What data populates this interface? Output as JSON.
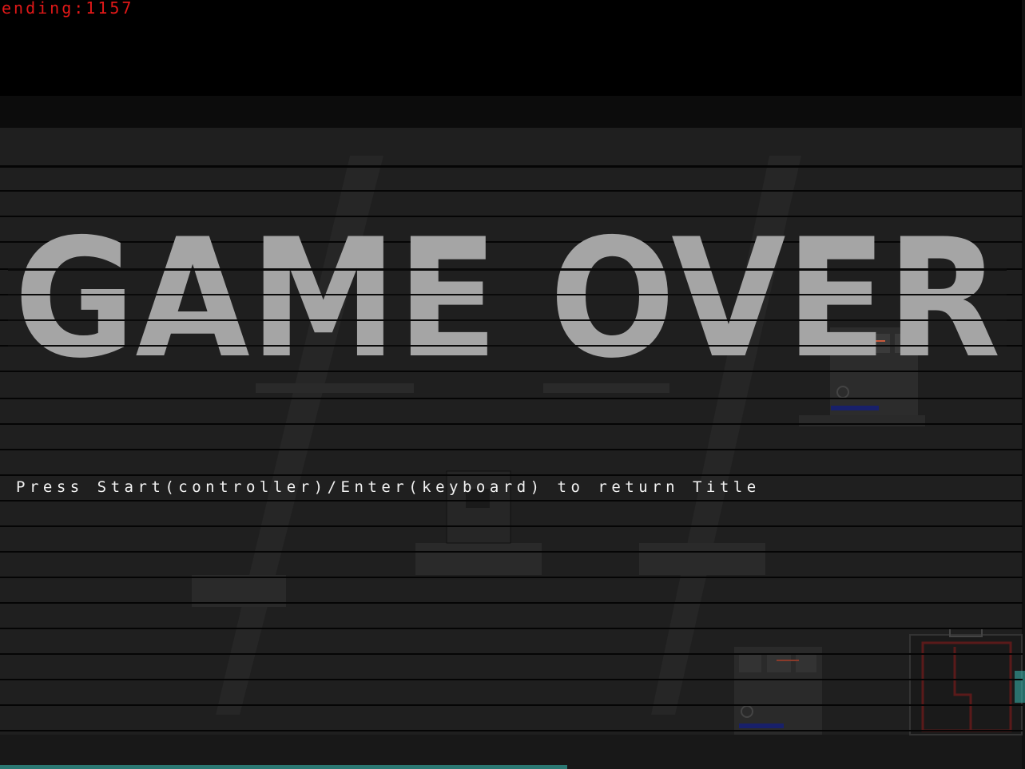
{
  "hud": {
    "ending_label": "ending:1157"
  },
  "game_over": {
    "title": "GAME OVER",
    "prompt": "Press Start(controller)/Enter(keyboard) to return Title"
  },
  "colors": {
    "background": "#000000",
    "room_wall": "#1e1e1e",
    "stripe": "#080808",
    "title_fill": "#a5a5a5",
    "hud_text": "#e01818",
    "prompt_text": "#f2f2f2",
    "accent_cyan": "#3cc8c0",
    "accent_red": "#c82828"
  }
}
